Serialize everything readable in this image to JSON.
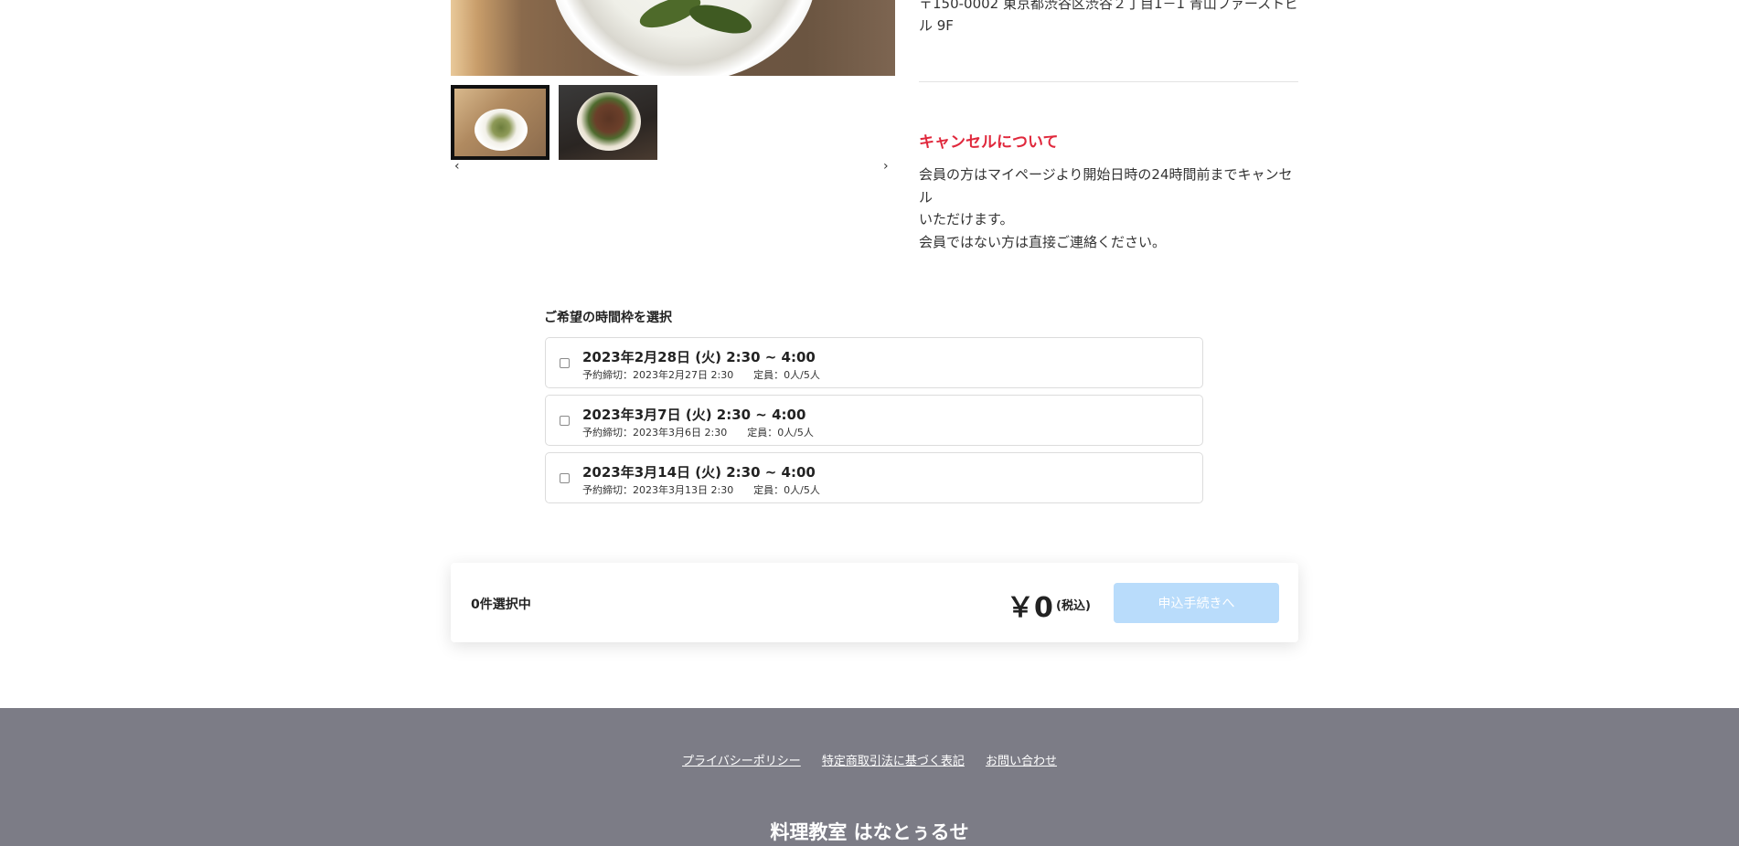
{
  "gallery": {
    "main_image_alt": "rice bowl with greens",
    "thumbnails": [
      {
        "label": "rice bowl thumbnail",
        "active": true
      },
      {
        "label": "beef rice bowl thumbnail",
        "active": false
      }
    ],
    "prev_icon": "chevron-left-icon",
    "next_icon": "chevron-right-icon",
    "prev_glyph": "‹",
    "next_glyph": "›"
  },
  "info": {
    "address_line1": "〒150-0002 東京都渋谷区渋谷２丁目1－1 青山ファーストビ",
    "address_line2": "ル 9F",
    "cancel_heading": "キャンセルについて",
    "cancel_line1": "会員の方はマイページより開始日時の24時間前までキャンセル",
    "cancel_line2": "いただけます。",
    "cancel_line3": "会員ではない方は直接ご連絡ください。"
  },
  "slots": {
    "heading": "ご希望の時間枠を選択",
    "items": [
      {
        "date": "2023年2月28日 (火) 2:30 ~ 4:00",
        "meta": "予約締切：2023年2月27日 2:30　　定員：0人/5人",
        "checked": false
      },
      {
        "date": "2023年3月7日 (火) 2:30 ~ 4:00",
        "meta": "予約締切：2023年3月6日 2:30　　定員：0人/5人",
        "checked": false
      },
      {
        "date": "2023年3月14日 (火) 2:30 ~ 4:00",
        "meta": "予約締切：2023年3月13日 2:30　　定員：0人/5人",
        "checked": false
      }
    ]
  },
  "summary": {
    "count_label": "0件選択中",
    "price": "￥0",
    "tax_label": "(税込)",
    "apply_label": "申込手続きへ",
    "apply_color": "#b9dcfb"
  },
  "footer": {
    "links": [
      "プライバシーポリシー",
      "特定商取引法に基づく表記",
      "お問い合わせ"
    ],
    "brand": "料理教室 はなとぅるせ",
    "background": "#7c7c86"
  },
  "colors": {
    "accent_red": "#e0283c"
  }
}
